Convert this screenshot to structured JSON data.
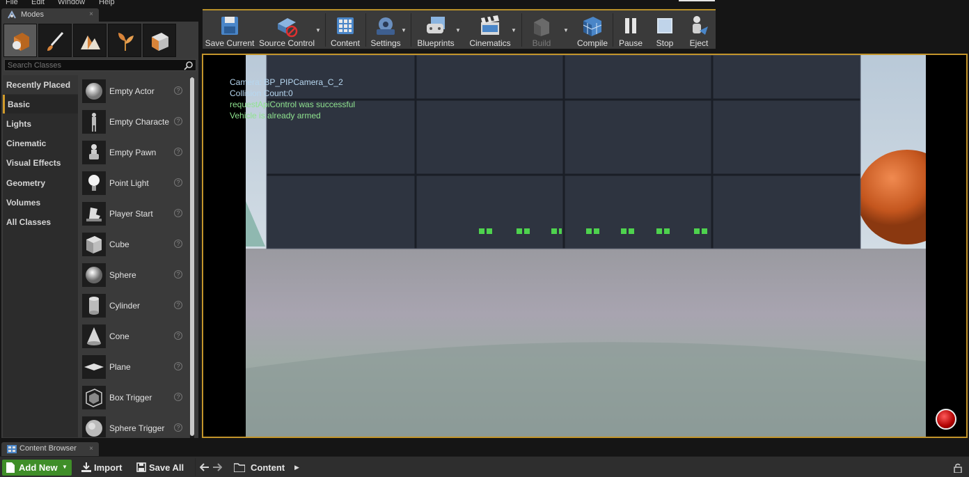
{
  "menu": {
    "items": [
      "File",
      "Edit",
      "Window",
      "Help"
    ]
  },
  "modes": {
    "tab_label": "Modes",
    "close": "×",
    "search_placeholder": "Search Classes",
    "mode_icons": [
      "place-mode-icon",
      "paint-mode-icon",
      "landscape-mode-icon",
      "foliage-mode-icon",
      "geometry-edit-mode-icon"
    ],
    "categories": [
      "Recently Placed",
      "Basic",
      "Lights",
      "Cinematic",
      "Visual Effects",
      "Geometry",
      "Volumes",
      "All Classes"
    ],
    "selected_category": "Basic",
    "items": [
      {
        "label": "Empty Actor",
        "icon": "sphere-icon"
      },
      {
        "label": "Empty Characte",
        "icon": "character-icon"
      },
      {
        "label": "Empty Pawn",
        "icon": "pawn-icon"
      },
      {
        "label": "Point Light",
        "icon": "light-bulb-icon"
      },
      {
        "label": "Player Start",
        "icon": "player-start-icon"
      },
      {
        "label": "Cube",
        "icon": "cube-icon"
      },
      {
        "label": "Sphere",
        "icon": "sphere-icon"
      },
      {
        "label": "Cylinder",
        "icon": "cylinder-icon"
      },
      {
        "label": "Cone",
        "icon": "cone-icon"
      },
      {
        "label": "Plane",
        "icon": "plane-icon"
      },
      {
        "label": "Box Trigger",
        "icon": "box-trigger-icon"
      },
      {
        "label": "Sphere Trigger",
        "icon": "sphere-trigger-icon"
      }
    ],
    "help_glyph": "?"
  },
  "toolbar": {
    "buttons": [
      {
        "label": "Save Current",
        "icon": "save-icon",
        "dropdown": false,
        "enabled": true
      },
      {
        "label": "Source Control",
        "icon": "source-control-icon",
        "dropdown": true,
        "enabled": true
      },
      {
        "label": "Content",
        "icon": "content-grid-icon",
        "dropdown": false,
        "enabled": true
      },
      {
        "label": "Settings",
        "icon": "settings-gear-icon",
        "dropdown": true,
        "enabled": true
      },
      {
        "label": "Blueprints",
        "icon": "blueprints-icon",
        "dropdown": true,
        "enabled": true
      },
      {
        "label": "Cinematics",
        "icon": "clapperboard-icon",
        "dropdown": true,
        "enabled": true
      },
      {
        "label": "Build",
        "icon": "build-icon",
        "dropdown": true,
        "enabled": false
      },
      {
        "label": "Compile",
        "icon": "compile-icon",
        "dropdown": false,
        "enabled": true
      },
      {
        "label": "Pause",
        "icon": "pause-icon",
        "dropdown": false,
        "enabled": true
      },
      {
        "label": "Stop",
        "icon": "stop-icon",
        "dropdown": false,
        "enabled": true
      },
      {
        "label": "Eject",
        "icon": "eject-icon",
        "dropdown": false,
        "enabled": true
      }
    ]
  },
  "viewport": {
    "overlay_lines": [
      "Camera: BP_PIPCamera_C_2",
      "Collision Count:0",
      "requestApiControl was successful",
      "Vehicle is already armed"
    ],
    "record_indicator": "recording-dot-icon"
  },
  "content_browser": {
    "tab_label": "Content Browser",
    "close": "×",
    "add_new": "Add New",
    "import": "Import",
    "save_all": "Save All",
    "path": "Content",
    "nav_back": "🡐",
    "nav_forward": "🡒"
  },
  "colors": {
    "accent": "#c3952b",
    "add_new_green": "#3f8e28",
    "overlay_green": "#8fe38f",
    "overlay_camera": "#b7d7f0"
  }
}
